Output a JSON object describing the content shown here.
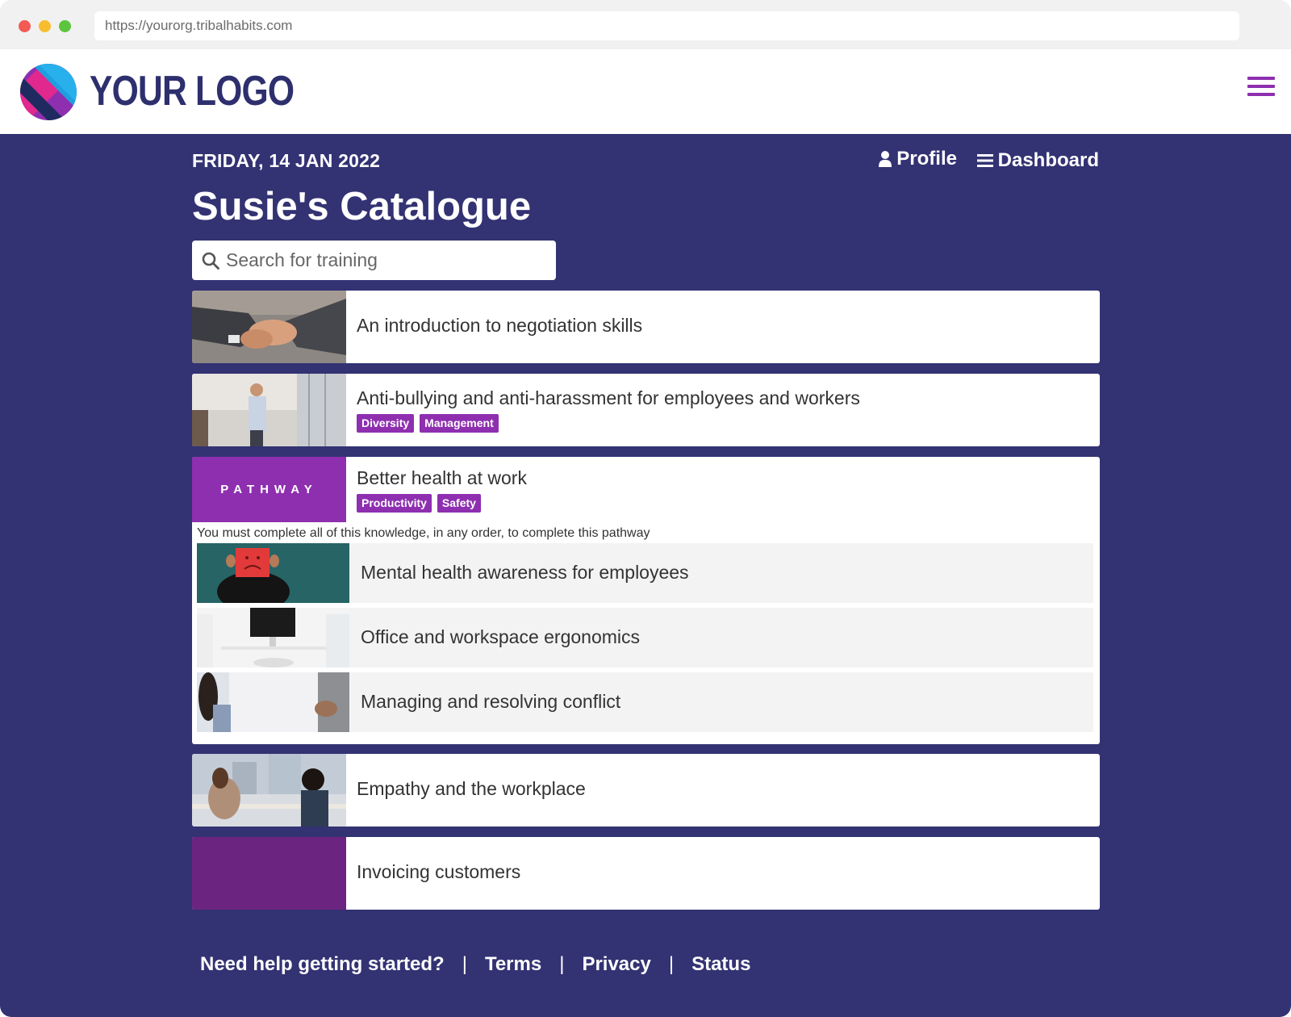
{
  "browser": {
    "url": "https://yourorg.tribalhabits.com"
  },
  "header": {
    "logo_text": "YOUR LOGO",
    "menu_icon": "hamburger-icon"
  },
  "page": {
    "date": "FRIDAY, 14 JAN 2022",
    "title": "Susie's Catalogue",
    "nav": {
      "profile": "Profile",
      "dashboard": "Dashboard"
    },
    "search": {
      "placeholder": "Search for training",
      "value": ""
    }
  },
  "courses": [
    {
      "title": "An introduction to negotiation skills",
      "tags": []
    },
    {
      "title": "Anti-bullying and anti-harassment for employees and workers",
      "tags": [
        "Diversity",
        "Management"
      ]
    },
    {
      "pathway_label": "PATHWAY",
      "title": "Better health at work",
      "tags": [
        "Productivity",
        "Safety"
      ],
      "note": "You must complete all of this knowledge, in any order, to complete this pathway",
      "items": [
        "Mental health awareness for employees",
        "Office and workspace ergonomics",
        "Managing and resolving conflict"
      ]
    },
    {
      "title": "Empathy and the workplace",
      "tags": []
    },
    {
      "title": "Invoicing customers",
      "tags": []
    }
  ],
  "footer": {
    "links": [
      "Need help getting started?",
      "Terms",
      "Privacy",
      "Status"
    ],
    "separator": "|"
  },
  "colors": {
    "brand_purple": "#8e2fb0",
    "navy": "#333273",
    "logo_text": "#2d2f6e"
  }
}
